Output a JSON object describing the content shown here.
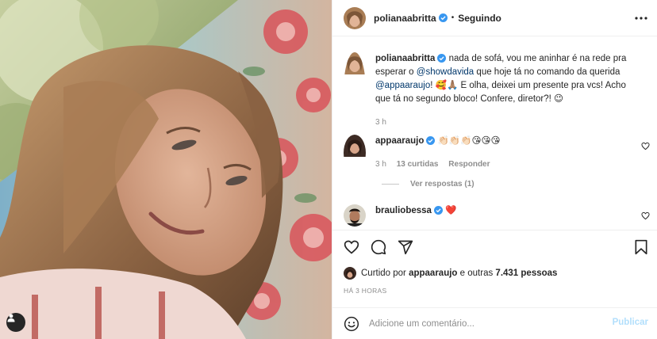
{
  "post": {
    "author": "polianaabritta",
    "follow_status": "Seguindo",
    "separator": "•",
    "caption": {
      "author": "polianaabritta",
      "text_1": "nada de sofá, vou me aninhar é na rede pra esperar o",
      "mention_1": "@showdavida",
      "text_2": "que hoje tá no comando da querida",
      "mention_2": "@appaaraujo",
      "text_3": "! 🥰🙏🏽 E olha, deixei um presente pra vcs! Acho que tá no segundo bloco! Confere, diretor?! 😉",
      "time": "3 h"
    }
  },
  "comments": [
    {
      "user": "appaaraujo",
      "text": "👏🏻👏🏻👏🏻😘😘😘",
      "time": "3 h",
      "likes": "13 curtidas",
      "reply_label": "Responder",
      "view_replies": "Ver respostas (1)"
    },
    {
      "user": "brauliobessa",
      "text": "❤️"
    }
  ],
  "likes": {
    "prefix": "Curtido por",
    "user": "appaaraujo",
    "suffix": "e outras",
    "count": "7.431",
    "unit": "pessoas"
  },
  "post_time": "HÁ 3 HORAS",
  "composer": {
    "placeholder": "Adicione um comentário...",
    "publish_label": "Publicar"
  },
  "icons": {
    "verified": "verified-badge-icon",
    "more": "more-options-icon",
    "like": "heart-icon",
    "comment": "comment-icon",
    "share": "share-icon",
    "save": "bookmark-icon",
    "emoji": "emoji-icon",
    "tag": "user-tag-icon"
  },
  "colors": {
    "verified_blue": "#3897f0",
    "mention": "#00376b",
    "muted": "#8e8e8e",
    "publish_disabled": "#b2dffc"
  }
}
